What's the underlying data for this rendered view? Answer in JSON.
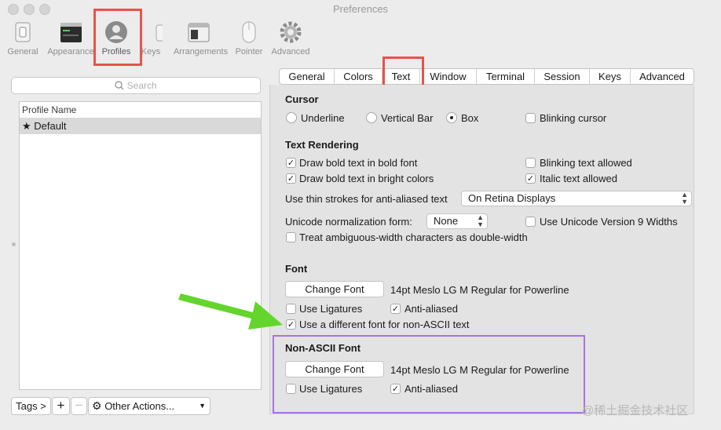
{
  "window": {
    "title": "Preferences"
  },
  "toolbar": {
    "items": [
      {
        "label": "General",
        "icon": "general-switch-icon"
      },
      {
        "label": "Appearance",
        "icon": "appearance-window-icon"
      },
      {
        "label": "Profiles",
        "icon": "profile-person-icon"
      },
      {
        "label": "Keys",
        "icon": "command-key-icon"
      },
      {
        "label": "Arrangements",
        "icon": "arrangements-window-icon"
      },
      {
        "label": "Pointer",
        "icon": "mouse-icon"
      },
      {
        "label": "Advanced",
        "icon": "gear-icon"
      }
    ],
    "selected": "Profiles"
  },
  "sidebar": {
    "search_placeholder": "Search",
    "list_header": "Profile Name",
    "profiles": [
      {
        "label": "★ Default"
      }
    ],
    "tags_button": "Tags >",
    "add_button": "+",
    "remove_button": "−",
    "other_actions": "Other Actions..."
  },
  "tabs": {
    "items": [
      "General",
      "Colors",
      "Text",
      "Window",
      "Terminal",
      "Session",
      "Keys",
      "Advanced"
    ],
    "selected": "Text"
  },
  "cursor": {
    "header": "Cursor",
    "options": [
      "Underline",
      "Vertical Bar",
      "Box"
    ],
    "selected": "Box",
    "blinking": {
      "label": "Blinking cursor",
      "checked": false
    }
  },
  "text_rendering": {
    "header": "Text Rendering",
    "bold_font": {
      "label": "Draw bold text in bold font",
      "checked": true
    },
    "bold_bright": {
      "label": "Draw bold text in bright colors",
      "checked": true
    },
    "blinking_allowed": {
      "label": "Blinking text allowed",
      "checked": false
    },
    "italic_allowed": {
      "label": "Italic text allowed",
      "checked": true
    },
    "thin_strokes_label": "Use thin strokes for anti-aliased text",
    "thin_strokes_value": "On Retina Displays",
    "unicode_norm_label": "Unicode normalization form:",
    "unicode_norm_value": "None",
    "unicode_v9": {
      "label": "Use Unicode Version 9 Widths",
      "checked": false
    },
    "ambiguous": {
      "label": "Treat ambiguous-width characters as double-width",
      "checked": false
    }
  },
  "font": {
    "header": "Font",
    "change_button": "Change Font",
    "description": "14pt Meslo LG M Regular for Powerline",
    "ligatures": {
      "label": "Use Ligatures",
      "checked": false
    },
    "antialiased": {
      "label": "Anti-aliased",
      "checked": true
    },
    "non_ascii_toggle": {
      "label": "Use a different font for non-ASCII text",
      "checked": true
    }
  },
  "non_ascii_font": {
    "header": "Non-ASCII Font",
    "change_button": "Change Font",
    "description": "14pt Meslo LG M Regular for Powerline",
    "ligatures": {
      "label": "Use Ligatures",
      "checked": false
    },
    "antialiased": {
      "label": "Anti-aliased",
      "checked": true
    }
  },
  "annotations": {
    "highlight_color": "#e8534a",
    "box_color": "#a874e0",
    "arrow_color": "#63d52d"
  },
  "watermark": {
    "text": "@稀土掘金技术社区"
  }
}
